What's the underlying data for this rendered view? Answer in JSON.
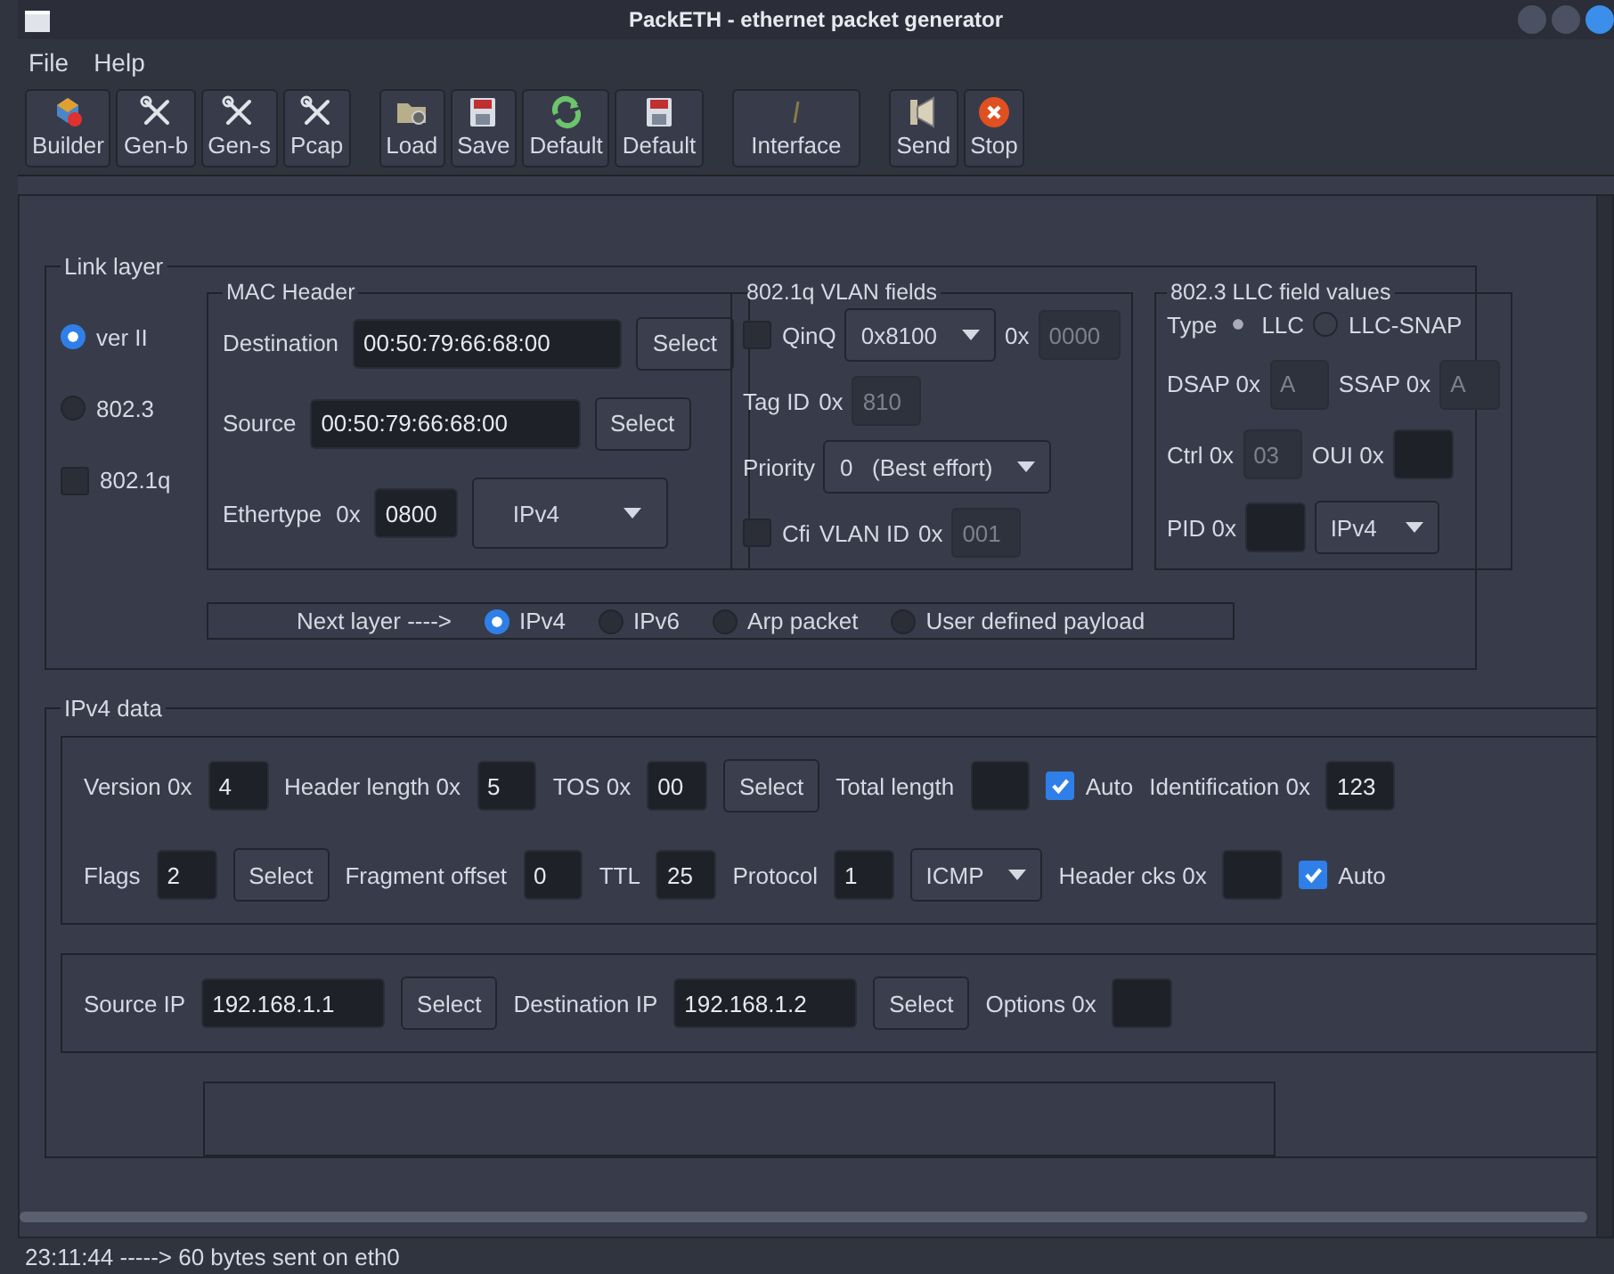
{
  "window": {
    "title": "PackETH - ethernet packet generator"
  },
  "menu": [
    "File",
    "Help"
  ],
  "toolbar": [
    [
      {
        "label": "Builder",
        "kind": "builder"
      },
      {
        "label": "Gen-b",
        "kind": "tools"
      },
      {
        "label": "Gen-s",
        "kind": "tools"
      },
      {
        "label": "Pcap",
        "kind": "tools"
      }
    ],
    [
      {
        "label": "Load",
        "kind": "folder"
      },
      {
        "label": "Save",
        "kind": "disk"
      },
      {
        "label": "Default",
        "kind": "reload"
      },
      {
        "label": "Default",
        "kind": "disk"
      }
    ],
    [
      {
        "label": "Interface",
        "kind": "plug"
      }
    ],
    [
      {
        "label": "Send",
        "kind": "speaker"
      },
      {
        "label": "Stop",
        "kind": "stop"
      }
    ]
  ],
  "link_layer": {
    "title": "Link layer",
    "types": [
      {
        "kind": "radio",
        "label": "ver II",
        "selected": true
      },
      {
        "kind": "radio",
        "label": "802.3",
        "selected": false
      },
      {
        "kind": "check",
        "label": "802.1q",
        "checked": false
      }
    ],
    "mac_header": {
      "title": "MAC Header",
      "lines": [
        {
          "items": [
            {
              "kind": "label",
              "text": "Destination"
            },
            {
              "kind": "field",
              "value": "00:50:79:66:68:00"
            },
            {
              "kind": "button",
              "label": "Select"
            }
          ]
        },
        {
          "items": [
            {
              "kind": "label",
              "text": "Source"
            },
            {
              "kind": "field",
              "value": "00:50:79:66:68:00"
            },
            {
              "kind": "button",
              "label": "Select"
            }
          ]
        },
        {
          "items": [
            {
              "kind": "label",
              "text": "Ethertype"
            },
            {
              "kind": "label",
              "text": "0x"
            },
            {
              "kind": "field",
              "value": "0800"
            },
            {
              "kind": "dropdown",
              "value": "IPv4"
            }
          ]
        }
      ]
    },
    "vlan": {
      "title": "802.1q VLAN fields",
      "lines": [
        {
          "items": [
            {
              "kind": "check",
              "label": "QinQ",
              "checked": false
            },
            {
              "kind": "dropdown",
              "value": "0x8100"
            },
            {
              "kind": "label",
              "text": "0x"
            },
            {
              "kind": "field",
              "value": "0000",
              "disabled": true
            }
          ]
        },
        {
          "items": [
            {
              "kind": "label",
              "text": "Tag ID"
            },
            {
              "kind": "label",
              "text": "0x"
            },
            {
              "kind": "field",
              "value": "810",
              "disabled": true
            }
          ]
        },
        {
          "items": [
            {
              "kind": "label",
              "text": "Priority"
            },
            {
              "kind": "dropdown",
              "value": "0   (Best effort)"
            }
          ]
        },
        {
          "items": [
            {
              "kind": "check",
              "label": "Cfi",
              "checked": false
            },
            {
              "kind": "label",
              "text": "VLAN ID"
            },
            {
              "kind": "label",
              "text": "0x"
            },
            {
              "kind": "field",
              "value": "001",
              "disabled": true
            }
          ]
        }
      ]
    },
    "llc": {
      "title": "802.3 LLC field values",
      "lines": [
        {
          "items": [
            {
              "kind": "label",
              "text": "Type"
            },
            {
              "kind": "radio",
              "label": "LLC",
              "selected": true,
              "disabled": true
            },
            {
              "kind": "radio",
              "label": "LLC-SNAP",
              "selected": false,
              "disabled": true
            }
          ]
        },
        {
          "items": [
            {
              "kind": "label",
              "text": "DSAP 0x"
            },
            {
              "kind": "field",
              "value": "A",
              "disabled": true
            },
            {
              "kind": "label",
              "text": "SSAP 0x"
            },
            {
              "kind": "field",
              "value": "A",
              "disabled": true
            }
          ]
        },
        {
          "items": [
            {
              "kind": "label",
              "text": "Ctrl 0x"
            },
            {
              "kind": "field",
              "value": "03",
              "disabled": true
            },
            {
              "kind": "label",
              "text": "OUI 0x"
            },
            {
              "kind": "field"
            }
          ]
        },
        {
          "items": [
            {
              "kind": "label",
              "text": "PID 0x"
            },
            {
              "kind": "field"
            },
            {
              "kind": "dropdown",
              "value": "IPv4"
            }
          ]
        }
      ]
    },
    "next_layer": [
      {
        "kind": "label",
        "text": "Next layer ---->"
      },
      {
        "kind": "radio",
        "label": "IPv4",
        "selected": true
      },
      {
        "kind": "radio",
        "label": "IPv6",
        "selected": false
      },
      {
        "kind": "radio",
        "label": "Arp packet",
        "selected": false
      },
      {
        "kind": "radio",
        "label": "User defined payload",
        "selected": false
      }
    ]
  },
  "ipv4": {
    "title": "IPv4 data",
    "groups": [
      {
        "lines": [
          {
            "items": [
              {
                "kind": "label",
                "text": "Version 0x"
              },
              {
                "kind": "field",
                "value": "4"
              },
              {
                "kind": "label",
                "text": "Header length 0x"
              },
              {
                "kind": "field",
                "value": "5"
              },
              {
                "kind": "label",
                "text": "TOS 0x"
              },
              {
                "kind": "field",
                "value": "00"
              },
              {
                "kind": "button",
                "label": "Select"
              },
              {
                "kind": "label",
                "text": "Total length"
              },
              {
                "kind": "field"
              },
              {
                "kind": "check",
                "label": "Auto",
                "checked": true
              },
              {
                "kind": "label",
                "text": "Identification 0x"
              },
              {
                "kind": "field",
                "value": "123"
              }
            ]
          },
          {
            "items": [
              {
                "kind": "label",
                "text": "Flags"
              },
              {
                "kind": "field",
                "value": "2"
              },
              {
                "kind": "button",
                "label": "Select"
              },
              {
                "kind": "label",
                "text": "Fragment offset"
              },
              {
                "kind": "field",
                "value": "0"
              },
              {
                "kind": "label",
                "text": "TTL"
              },
              {
                "kind": "field",
                "value": "25"
              },
              {
                "kind": "label",
                "text": "Protocol"
              },
              {
                "kind": "field",
                "value": "1"
              },
              {
                "kind": "dropdown",
                "value": "ICMP"
              },
              {
                "kind": "label",
                "text": "Header cks 0x"
              },
              {
                "kind": "field"
              },
              {
                "kind": "check",
                "label": "Auto",
                "checked": true
              }
            ]
          }
        ]
      },
      {
        "lines": [
          {
            "items": [
              {
                "kind": "label",
                "text": "Source IP"
              },
              {
                "kind": "field",
                "value": "192.168.1.1"
              },
              {
                "kind": "button",
                "label": "Select"
              },
              {
                "kind": "label",
                "text": "Destination IP"
              },
              {
                "kind": "field",
                "value": "192.168.1.2"
              },
              {
                "kind": "button",
                "label": "Select"
              },
              {
                "kind": "label",
                "text": "Options 0x"
              },
              {
                "kind": "field"
              }
            ]
          }
        ]
      }
    ]
  },
  "status_bar": "23:11:44 -----> 60 bytes sent on eth0"
}
